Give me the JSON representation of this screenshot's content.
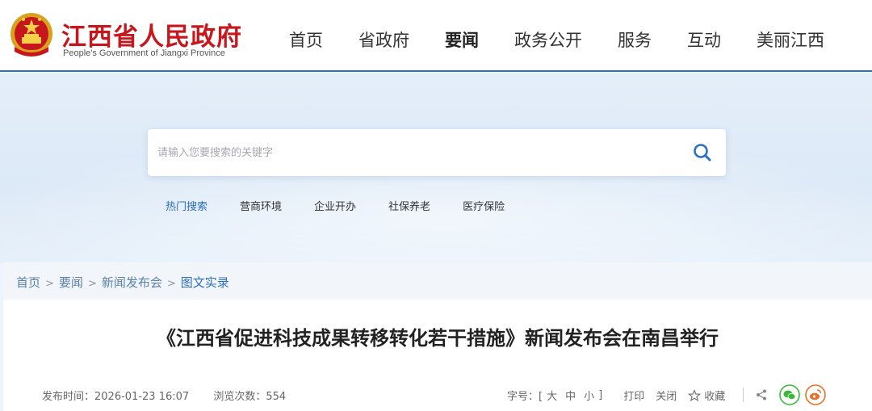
{
  "header": {
    "logo_cn": "江西省人民政府",
    "logo_en": "People's Government of Jiangxi Province",
    "nav": [
      {
        "label": "首页"
      },
      {
        "label": "省政府"
      },
      {
        "label": "要闻",
        "active": true
      },
      {
        "label": "政务公开"
      },
      {
        "label": "服务"
      },
      {
        "label": "互动"
      },
      {
        "label": "美丽江西"
      }
    ]
  },
  "search": {
    "placeholder": "请输入您要搜索的关键字",
    "value": "",
    "hot_label": "热门搜索",
    "hot_items": [
      "营商环境",
      "企业开办",
      "社保养老",
      "医疗保险"
    ]
  },
  "breadcrumb": {
    "items": [
      "首页",
      "要闻",
      "新闻发布会"
    ],
    "current": "图文实录",
    "separator": ">"
  },
  "article": {
    "title": "《江西省促进科技成果转移转化若干措施》新闻发布会在南昌举行",
    "publish_label": "发布时间：",
    "publish_time": "2026-01-23 16:07",
    "views_label": "浏览次数：",
    "views": "554"
  },
  "tools": {
    "font_label": "字号：[",
    "font_large": "大",
    "font_mid": "中",
    "font_small": "小",
    "font_end": "]",
    "print": "打印",
    "close": "关闭",
    "favorite": "收藏"
  },
  "colors": {
    "brand_red": "#c8161d",
    "accent_blue": "#2b6fc2",
    "wechat_green": "#3db83a",
    "weibo_orange": "#e8702a"
  }
}
